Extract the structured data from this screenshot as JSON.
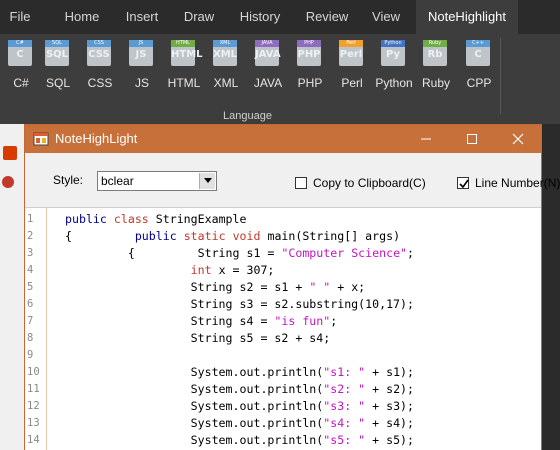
{
  "ribbon": {
    "tabs": [
      "File",
      "Home",
      "Insert",
      "Draw",
      "History",
      "Review",
      "View",
      "NoteHighlight"
    ],
    "active_tab": "NoteHighlight",
    "languages": [
      {
        "label": "C#",
        "band": "C#",
        "glyph": "C",
        "color": "#5b9bd5"
      },
      {
        "label": "SQL",
        "band": "SQL",
        "glyph": "SQL",
        "color": "#5b9bd5"
      },
      {
        "label": "CSS",
        "band": "CSS",
        "glyph": "CSS",
        "color": "#5b9bd5"
      },
      {
        "label": "JS",
        "band": "JS",
        "glyph": "JS",
        "color": "#5b9bd5"
      },
      {
        "label": "HTML",
        "band": "HTML",
        "glyph": "HTML",
        "color": "#70ad47"
      },
      {
        "label": "XML",
        "band": "XML",
        "glyph": "XML",
        "color": "#5b9bd5"
      },
      {
        "label": "JAVA",
        "band": "JAVA",
        "glyph": "JAVA",
        "color": "#8e6cc0"
      },
      {
        "label": "PHP",
        "band": "PHP",
        "glyph": "PHP",
        "color": "#8e6cc0"
      },
      {
        "label": "Perl",
        "band": "Perl",
        "glyph": "Perl",
        "color": "#f0a030"
      },
      {
        "label": "Python",
        "band": "Python",
        "glyph": "Py",
        "color": "#4472c4"
      },
      {
        "label": "Ruby",
        "band": "Ruby",
        "glyph": "Rb",
        "color": "#70ad47"
      },
      {
        "label": "CPP",
        "band": "C++",
        "glyph": "C",
        "color": "#5b9bd5"
      }
    ],
    "group_label": "Language"
  },
  "dialog": {
    "title": "NoteHighLight",
    "style_label": "Style:",
    "style_value": "bclear",
    "copy_label": "Copy to Clipboard(C)",
    "copy_checked": false,
    "linenum_label": "Line Number(N)",
    "linenum_checked": true,
    "accent": "#c8703a"
  },
  "code_lines": [
    {
      "n": "1",
      "parts": [
        [
          "kw",
          "public"
        ],
        [
          "",
          " "
        ],
        [
          "kw2",
          "class"
        ],
        [
          "",
          " StringExample"
        ]
      ]
    },
    {
      "n": "2",
      "parts": [
        [
          "",
          "{         "
        ],
        [
          "kw",
          "public"
        ],
        [
          "",
          " "
        ],
        [
          "kw2",
          "static"
        ],
        [
          "",
          " "
        ],
        [
          "kw2",
          "void"
        ],
        [
          "",
          " main(String[] args)"
        ]
      ]
    },
    {
      "n": "3",
      "parts": [
        [
          "",
          "         {         String s1 = "
        ],
        [
          "str",
          "\"Computer Science\""
        ],
        [
          "",
          ";"
        ]
      ]
    },
    {
      "n": "4",
      "parts": [
        [
          "",
          "                  "
        ],
        [
          "kw2",
          "int"
        ],
        [
          "",
          " x = 307;"
        ]
      ]
    },
    {
      "n": "5",
      "parts": [
        [
          "",
          "                  String s2 = s1 + "
        ],
        [
          "str",
          "\" \""
        ],
        [
          "",
          " + x;"
        ]
      ]
    },
    {
      "n": "6",
      "parts": [
        [
          "",
          "                  String s3 = s2.substring(10,17);"
        ]
      ]
    },
    {
      "n": "7",
      "parts": [
        [
          "",
          "                  String s4 = "
        ],
        [
          "str",
          "\"is fun\""
        ],
        [
          "",
          ";"
        ]
      ]
    },
    {
      "n": "8",
      "parts": [
        [
          "",
          "                  String s5 = s2 + s4;"
        ]
      ]
    },
    {
      "n": "9",
      "parts": [
        [
          "",
          ""
        ]
      ]
    },
    {
      "n": "10",
      "parts": [
        [
          "",
          "                  System.out.println("
        ],
        [
          "str",
          "\"s1: \""
        ],
        [
          "",
          " + s1);"
        ]
      ]
    },
    {
      "n": "11",
      "parts": [
        [
          "",
          "                  System.out.println("
        ],
        [
          "str",
          "\"s2: \""
        ],
        [
          "",
          " + s2);"
        ]
      ]
    },
    {
      "n": "12",
      "parts": [
        [
          "",
          "                  System.out.println("
        ],
        [
          "str",
          "\"s3: \""
        ],
        [
          "",
          " + s3);"
        ]
      ]
    },
    {
      "n": "13",
      "parts": [
        [
          "",
          "                  System.out.println("
        ],
        [
          "str",
          "\"s4: \""
        ],
        [
          "",
          " + s4);"
        ]
      ]
    },
    {
      "n": "14",
      "parts": [
        [
          "",
          "                  System.out.println("
        ],
        [
          "str",
          "\"s5: \""
        ],
        [
          "",
          " + s5);"
        ]
      ]
    }
  ]
}
